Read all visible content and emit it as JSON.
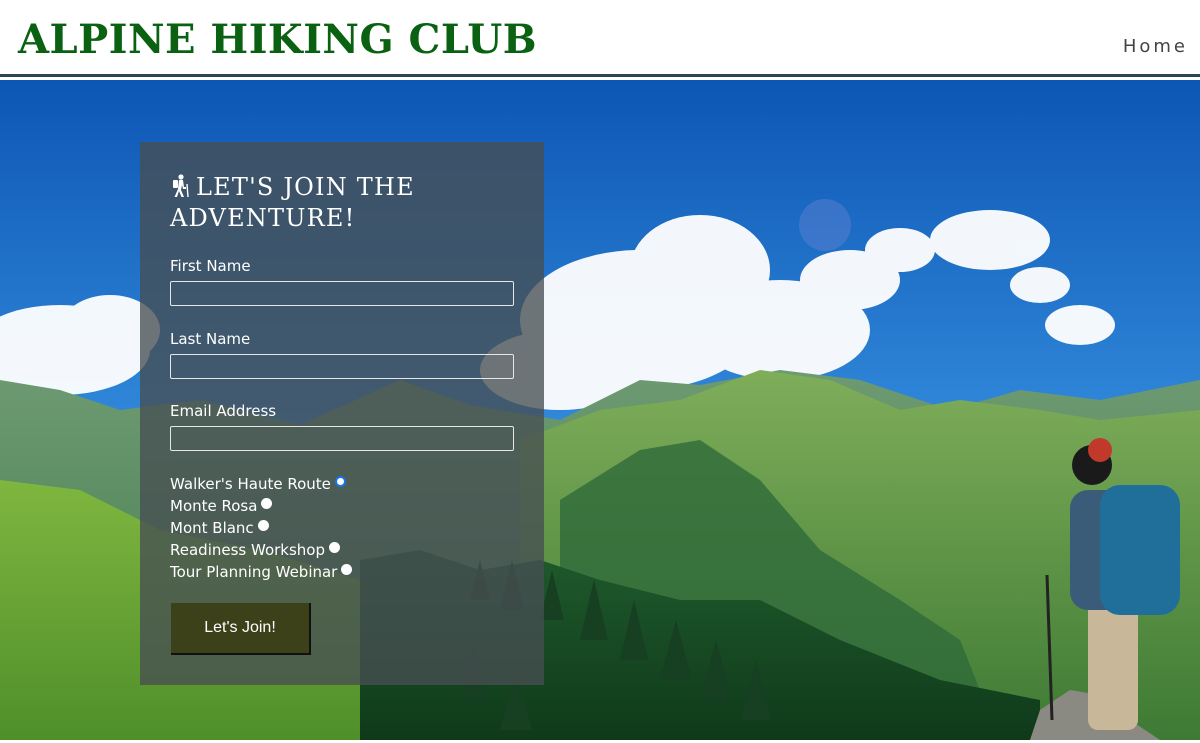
{
  "header": {
    "brand": "ALPINE HIKING CLUB",
    "nav": {
      "home": "Home"
    }
  },
  "form": {
    "title": "LET'S JOIN THE ADVENTURE!",
    "fields": [
      {
        "label": "First Name",
        "value": ""
      },
      {
        "label": "Last Name",
        "value": ""
      },
      {
        "label": "Email Address",
        "value": ""
      }
    ],
    "options": [
      {
        "label": "Walker's Haute Route",
        "checked": true
      },
      {
        "label": "Monte Rosa",
        "checked": false
      },
      {
        "label": "Mont Blanc",
        "checked": false
      },
      {
        "label": "Readiness Workshop",
        "checked": false
      },
      {
        "label": "Tour Planning Webinar",
        "checked": false
      }
    ],
    "submit_label": "Let's Join!"
  },
  "colors": {
    "brand": "#0a6112",
    "header_border": "#2b4556",
    "button_bg": "#3c4119",
    "radio_focus": "#1a73e8"
  },
  "icons": {
    "title_icon": "hiker-icon"
  }
}
